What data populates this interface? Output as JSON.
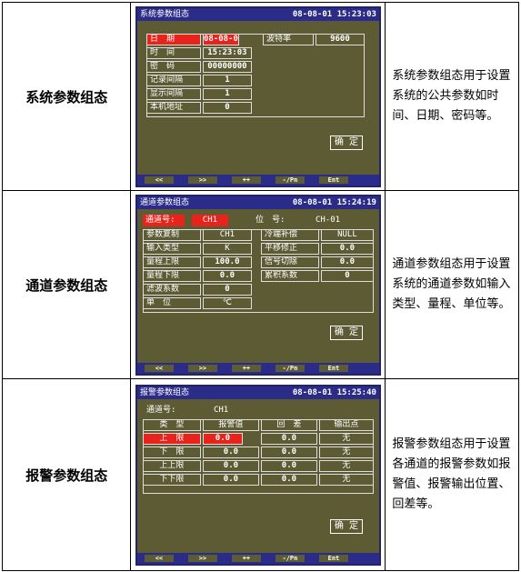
{
  "rows": [
    {
      "title": "系统参数组态",
      "description": "系统参数组态用于设置系统的公共参数如时间、日期、密码等。",
      "screen": {
        "header": "系统参数组态",
        "clock": "08-08-01 15:23:03",
        "fields": [
          {
            "label": "日　期",
            "value": "08-08-01"
          },
          {
            "label": "时　间",
            "value": "15:23:03"
          },
          {
            "label": "密　码",
            "value": "00000000"
          },
          {
            "label": "记录间隔",
            "value": "1"
          },
          {
            "label": "显示间隔",
            "value": "1"
          },
          {
            "label": "本机地址",
            "value": "0"
          }
        ],
        "right_field": {
          "label": "波特率",
          "value": "9600"
        },
        "confirm": "确 定"
      }
    },
    {
      "title": "通道参数组态",
      "description": "通道参数组态用于设置系统的通道参数如输入类型、量程、单位等。",
      "screen": {
        "header": "通道参数组态",
        "clock": "08-08-01 15:24:19",
        "channel_label": "通道号:",
        "channel_value": "CH1",
        "tag_label": "位　号:",
        "tag_value": "CH-01",
        "left_fields": [
          {
            "label": "参数复制",
            "value": "CH1"
          },
          {
            "label": "输入类型",
            "value": "K"
          },
          {
            "label": "量程上限",
            "value": "100.0"
          },
          {
            "label": "量程下限",
            "value": "0.0"
          },
          {
            "label": "滤波系数",
            "value": "0"
          },
          {
            "label": "单　位",
            "value": "℃"
          }
        ],
        "right_fields": [
          {
            "label": "冷端补偿",
            "value": "NULL"
          },
          {
            "label": "平移修正",
            "value": "0.0"
          },
          {
            "label": "信号切除",
            "value": "0.0"
          },
          {
            "label": "累积系数",
            "value": "0"
          }
        ],
        "confirm": "确 定"
      }
    },
    {
      "title": "报警参数组态",
      "description": "报警参数组态用于设置各通道的报警参数如报警值、报警输出位置、回差等。",
      "screen": {
        "header": "报警参数组态",
        "clock": "08-08-01 15:25:40",
        "channel_label": "通道号:",
        "channel_value": "CH1",
        "columns": [
          "类　型",
          "报警值",
          "回　差",
          "输出点"
        ],
        "alarms": [
          {
            "type": "上　限",
            "value": "0.0",
            "hyst": "0.0",
            "out": "无"
          },
          {
            "type": "下　限",
            "value": "0.0",
            "hyst": "0.0",
            "out": "无"
          },
          {
            "type": "上上限",
            "value": "0.0",
            "hyst": "0.0",
            "out": "无"
          },
          {
            "type": "下下限",
            "value": "0.0",
            "hyst": "0.0",
            "out": "无"
          }
        ],
        "confirm": "确 定"
      }
    }
  ],
  "fkeys": [
    "<<",
    ">>",
    "++",
    "-/Pn",
    "Ent"
  ],
  "colors": {
    "screen_bg": "#5d5b34",
    "bar_bg": "#2b2b8a",
    "highlight": "#e8231b"
  }
}
